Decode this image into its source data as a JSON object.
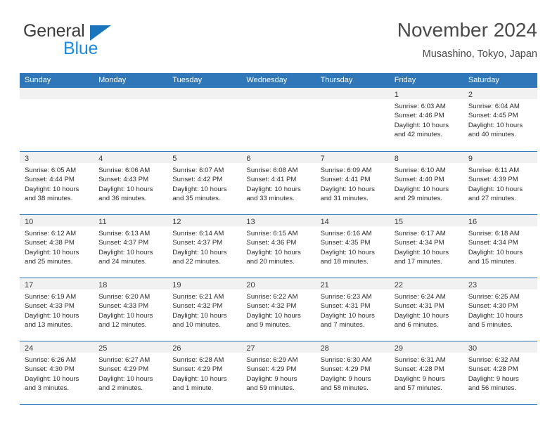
{
  "brand": {
    "name_part1": "General",
    "name_part2": "Blue",
    "triangle_icon": "triangle-icon",
    "color_dark": "#3c3c3c",
    "color_blue": "#1b8ae0",
    "color_triangle": "#1b75bc"
  },
  "header": {
    "title": "November 2024",
    "subtitle": "Musashino, Tokyo, Japan"
  },
  "theme": {
    "header_blue": "#2f77b8",
    "day_band_gray": "#f1f1f1",
    "text": "#2b2b2b"
  },
  "weekdays": [
    "Sunday",
    "Monday",
    "Tuesday",
    "Wednesday",
    "Thursday",
    "Friday",
    "Saturday"
  ],
  "weeks": [
    {
      "days": [
        {
          "num": "",
          "sunrise": "",
          "sunset": "",
          "daylight1": "",
          "daylight2": "",
          "empty": true
        },
        {
          "num": "",
          "sunrise": "",
          "sunset": "",
          "daylight1": "",
          "daylight2": "",
          "empty": true
        },
        {
          "num": "",
          "sunrise": "",
          "sunset": "",
          "daylight1": "",
          "daylight2": "",
          "empty": true
        },
        {
          "num": "",
          "sunrise": "",
          "sunset": "",
          "daylight1": "",
          "daylight2": "",
          "empty": true
        },
        {
          "num": "",
          "sunrise": "",
          "sunset": "",
          "daylight1": "",
          "daylight2": "",
          "empty": true
        },
        {
          "num": "1",
          "sunrise": "Sunrise: 6:03 AM",
          "sunset": "Sunset: 4:46 PM",
          "daylight1": "Daylight: 10 hours",
          "daylight2": "and 42 minutes."
        },
        {
          "num": "2",
          "sunrise": "Sunrise: 6:04 AM",
          "sunset": "Sunset: 4:45 PM",
          "daylight1": "Daylight: 10 hours",
          "daylight2": "and 40 minutes."
        }
      ]
    },
    {
      "days": [
        {
          "num": "3",
          "sunrise": "Sunrise: 6:05 AM",
          "sunset": "Sunset: 4:44 PM",
          "daylight1": "Daylight: 10 hours",
          "daylight2": "and 38 minutes."
        },
        {
          "num": "4",
          "sunrise": "Sunrise: 6:06 AM",
          "sunset": "Sunset: 4:43 PM",
          "daylight1": "Daylight: 10 hours",
          "daylight2": "and 36 minutes."
        },
        {
          "num": "5",
          "sunrise": "Sunrise: 6:07 AM",
          "sunset": "Sunset: 4:42 PM",
          "daylight1": "Daylight: 10 hours",
          "daylight2": "and 35 minutes."
        },
        {
          "num": "6",
          "sunrise": "Sunrise: 6:08 AM",
          "sunset": "Sunset: 4:41 PM",
          "daylight1": "Daylight: 10 hours",
          "daylight2": "and 33 minutes."
        },
        {
          "num": "7",
          "sunrise": "Sunrise: 6:09 AM",
          "sunset": "Sunset: 4:41 PM",
          "daylight1": "Daylight: 10 hours",
          "daylight2": "and 31 minutes."
        },
        {
          "num": "8",
          "sunrise": "Sunrise: 6:10 AM",
          "sunset": "Sunset: 4:40 PM",
          "daylight1": "Daylight: 10 hours",
          "daylight2": "and 29 minutes."
        },
        {
          "num": "9",
          "sunrise": "Sunrise: 6:11 AM",
          "sunset": "Sunset: 4:39 PM",
          "daylight1": "Daylight: 10 hours",
          "daylight2": "and 27 minutes."
        }
      ]
    },
    {
      "days": [
        {
          "num": "10",
          "sunrise": "Sunrise: 6:12 AM",
          "sunset": "Sunset: 4:38 PM",
          "daylight1": "Daylight: 10 hours",
          "daylight2": "and 25 minutes."
        },
        {
          "num": "11",
          "sunrise": "Sunrise: 6:13 AM",
          "sunset": "Sunset: 4:37 PM",
          "daylight1": "Daylight: 10 hours",
          "daylight2": "and 24 minutes."
        },
        {
          "num": "12",
          "sunrise": "Sunrise: 6:14 AM",
          "sunset": "Sunset: 4:37 PM",
          "daylight1": "Daylight: 10 hours",
          "daylight2": "and 22 minutes."
        },
        {
          "num": "13",
          "sunrise": "Sunrise: 6:15 AM",
          "sunset": "Sunset: 4:36 PM",
          "daylight1": "Daylight: 10 hours",
          "daylight2": "and 20 minutes."
        },
        {
          "num": "14",
          "sunrise": "Sunrise: 6:16 AM",
          "sunset": "Sunset: 4:35 PM",
          "daylight1": "Daylight: 10 hours",
          "daylight2": "and 18 minutes."
        },
        {
          "num": "15",
          "sunrise": "Sunrise: 6:17 AM",
          "sunset": "Sunset: 4:34 PM",
          "daylight1": "Daylight: 10 hours",
          "daylight2": "and 17 minutes."
        },
        {
          "num": "16",
          "sunrise": "Sunrise: 6:18 AM",
          "sunset": "Sunset: 4:34 PM",
          "daylight1": "Daylight: 10 hours",
          "daylight2": "and 15 minutes."
        }
      ]
    },
    {
      "days": [
        {
          "num": "17",
          "sunrise": "Sunrise: 6:19 AM",
          "sunset": "Sunset: 4:33 PM",
          "daylight1": "Daylight: 10 hours",
          "daylight2": "and 13 minutes."
        },
        {
          "num": "18",
          "sunrise": "Sunrise: 6:20 AM",
          "sunset": "Sunset: 4:33 PM",
          "daylight1": "Daylight: 10 hours",
          "daylight2": "and 12 minutes."
        },
        {
          "num": "19",
          "sunrise": "Sunrise: 6:21 AM",
          "sunset": "Sunset: 4:32 PM",
          "daylight1": "Daylight: 10 hours",
          "daylight2": "and 10 minutes."
        },
        {
          "num": "20",
          "sunrise": "Sunrise: 6:22 AM",
          "sunset": "Sunset: 4:32 PM",
          "daylight1": "Daylight: 10 hours",
          "daylight2": "and 9 minutes."
        },
        {
          "num": "21",
          "sunrise": "Sunrise: 6:23 AM",
          "sunset": "Sunset: 4:31 PM",
          "daylight1": "Daylight: 10 hours",
          "daylight2": "and 7 minutes."
        },
        {
          "num": "22",
          "sunrise": "Sunrise: 6:24 AM",
          "sunset": "Sunset: 4:31 PM",
          "daylight1": "Daylight: 10 hours",
          "daylight2": "and 6 minutes."
        },
        {
          "num": "23",
          "sunrise": "Sunrise: 6:25 AM",
          "sunset": "Sunset: 4:30 PM",
          "daylight1": "Daylight: 10 hours",
          "daylight2": "and 5 minutes."
        }
      ]
    },
    {
      "days": [
        {
          "num": "24",
          "sunrise": "Sunrise: 6:26 AM",
          "sunset": "Sunset: 4:30 PM",
          "daylight1": "Daylight: 10 hours",
          "daylight2": "and 3 minutes."
        },
        {
          "num": "25",
          "sunrise": "Sunrise: 6:27 AM",
          "sunset": "Sunset: 4:29 PM",
          "daylight1": "Daylight: 10 hours",
          "daylight2": "and 2 minutes."
        },
        {
          "num": "26",
          "sunrise": "Sunrise: 6:28 AM",
          "sunset": "Sunset: 4:29 PM",
          "daylight1": "Daylight: 10 hours",
          "daylight2": "and 1 minute."
        },
        {
          "num": "27",
          "sunrise": "Sunrise: 6:29 AM",
          "sunset": "Sunset: 4:29 PM",
          "daylight1": "Daylight: 9 hours",
          "daylight2": "and 59 minutes."
        },
        {
          "num": "28",
          "sunrise": "Sunrise: 6:30 AM",
          "sunset": "Sunset: 4:29 PM",
          "daylight1": "Daylight: 9 hours",
          "daylight2": "and 58 minutes."
        },
        {
          "num": "29",
          "sunrise": "Sunrise: 6:31 AM",
          "sunset": "Sunset: 4:28 PM",
          "daylight1": "Daylight: 9 hours",
          "daylight2": "and 57 minutes."
        },
        {
          "num": "30",
          "sunrise": "Sunrise: 6:32 AM",
          "sunset": "Sunset: 4:28 PM",
          "daylight1": "Daylight: 9 hours",
          "daylight2": "and 56 minutes."
        }
      ]
    }
  ]
}
